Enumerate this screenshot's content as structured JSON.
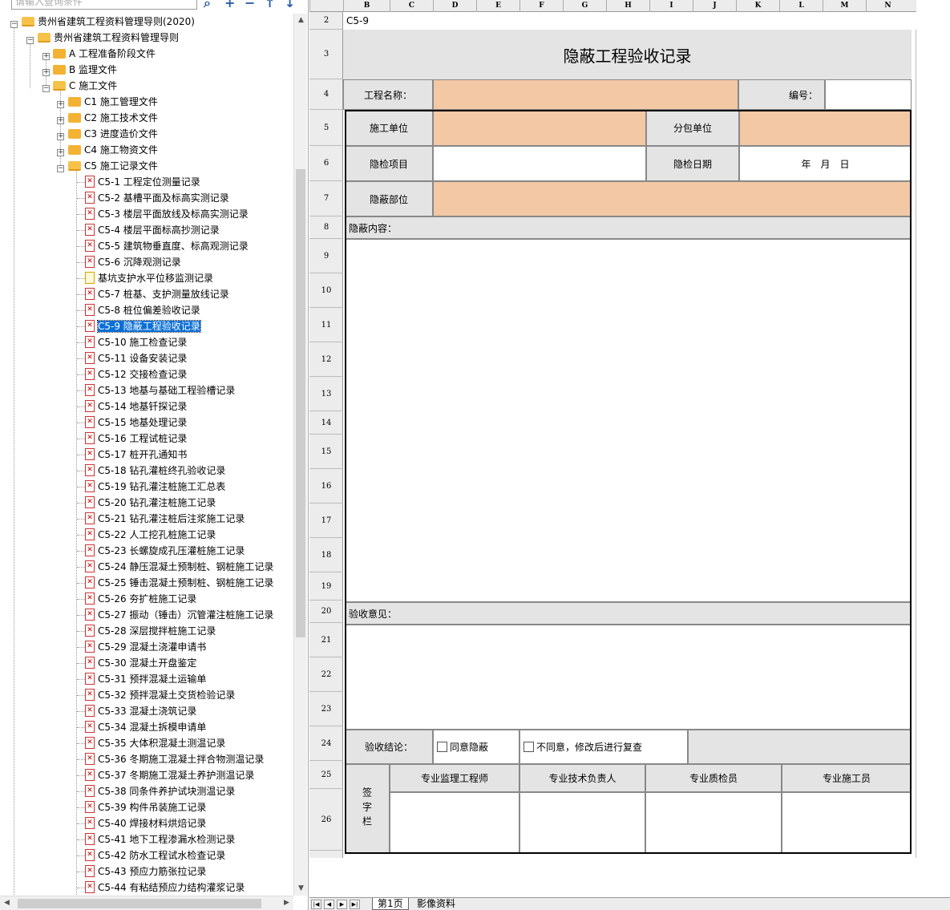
{
  "search": {
    "placeholder": "请输入查询条件"
  },
  "tree": {
    "root": "贵州省建筑工程资料管理导则(2020)",
    "sub": "贵州省建筑工程资料管理导则",
    "A": "A 工程准备阶段文件",
    "B": "B 监理文件",
    "C": "C 施工文件",
    "C1": "C1 施工管理文件",
    "C2": "C2 施工技术文件",
    "C3": "C3 进度造价文件",
    "C4": "C4 施工物资文件",
    "C5": "C5 施工记录文件",
    "items": [
      "C5-1 工程定位测量记录",
      "C5-2 基槽平面及标高实测记录",
      "C5-3 楼层平面放线及标高实测记录",
      "C5-4 楼层平面标高抄测记录",
      "C5-5 建筑物垂直度、标高观测记录",
      "C5-6 沉降观测记录",
      "基坑支护水平位移监测记录",
      "C5-7 桩基、支护测量放线记录",
      "C5-8 桩位偏差验收记录",
      "C5-9 隐蔽工程验收记录",
      "C5-10 施工检查记录",
      "C5-11 设备安装记录",
      "C5-12 交接检查记录",
      "C5-13 地基与基础工程验槽记录",
      "C5-14 地基钎探记录",
      "C5-15 地基处理记录",
      "C5-16 工程试桩记录",
      "C5-17 桩开孔通知书",
      "C5-18 钻孔灌桩终孔验收记录",
      "C5-19 钻孔灌注桩施工汇总表",
      "C5-20 钻孔灌注桩施工记录",
      "C5-21 钻孔灌注桩后注浆施工记录",
      "C5-22 人工挖孔桩施工记录",
      "C5-23 长螺旋成孔压灌桩施工记录",
      "C5-24 静压混凝土预制桩、钢桩施工记录",
      "C5-25 锤击混凝土预制桩、钢桩施工记录",
      "C5-26 夯扩桩施工记录",
      "C5-27 振动（锤击）沉管灌注桩施工记录",
      "C5-28 深层搅拌桩施工记录",
      "C5-29 混凝土浇灌申请书",
      "C5-30 混凝土开盘鉴定",
      "C5-31 预拌混凝土运输单",
      "C5-32 预拌混凝土交货检验记录",
      "C5-33 混凝土浇筑记录",
      "C5-34 混凝土拆模申请单",
      "C5-35 大体积混凝土测温记录",
      "C5-36 冬期施工混凝土拌合物测温记录",
      "C5-37 冬期施工混凝土养护测温记录",
      "C5-38 同条件养护试块测温记录",
      "C5-39 构件吊装施工记录",
      "C5-40 焊接材料烘焙记录",
      "C5-41 地下工程渗漏水检测记录",
      "C5-42 防水工程试水检查记录",
      "C5-43 预应力筋张拉记录",
      "C5-44 有粘结预应力结构灌浆记录"
    ],
    "selected_index": 9
  },
  "columns": [
    "B",
    "C",
    "D",
    "E",
    "F",
    "G",
    "H",
    "I",
    "J",
    "K",
    "L",
    "M",
    "N"
  ],
  "rows": [
    "2",
    "3",
    "4",
    "5",
    "6",
    "7",
    "8",
    "9",
    "10",
    "11",
    "12",
    "13",
    "14",
    "15",
    "16",
    "17",
    "18",
    "19",
    "20",
    "21",
    "22",
    "23",
    "24",
    "25",
    "26"
  ],
  "form": {
    "code": "C5-9",
    "title": "隐蔽工程验收记录",
    "project_name_label": "工程名称：",
    "number_label": "编号：",
    "construction_unit": "施工单位",
    "sub_unit": "分包单位",
    "check_item": "隐检项目",
    "check_date": "隐检日期",
    "date_value": "年　月　日",
    "hidden_part": "隐蔽部位",
    "hidden_content": "隐蔽内容：",
    "opinion": "验收意见：",
    "conclusion": "验收结论：",
    "agree": "同意隐蔽",
    "disagree": "不同意，修改后进行复查",
    "sign_col": "签字栏",
    "sign_headers": [
      "专业监理工程师",
      "专业技术负责人",
      "专业质检员",
      "专业施工员"
    ]
  },
  "sheet_tabs": [
    "第1页",
    "影像资料"
  ],
  "colors": {
    "peach": "#f2c8a5",
    "gray": "#e4e4e4",
    "selection": "#0a6fd8"
  }
}
